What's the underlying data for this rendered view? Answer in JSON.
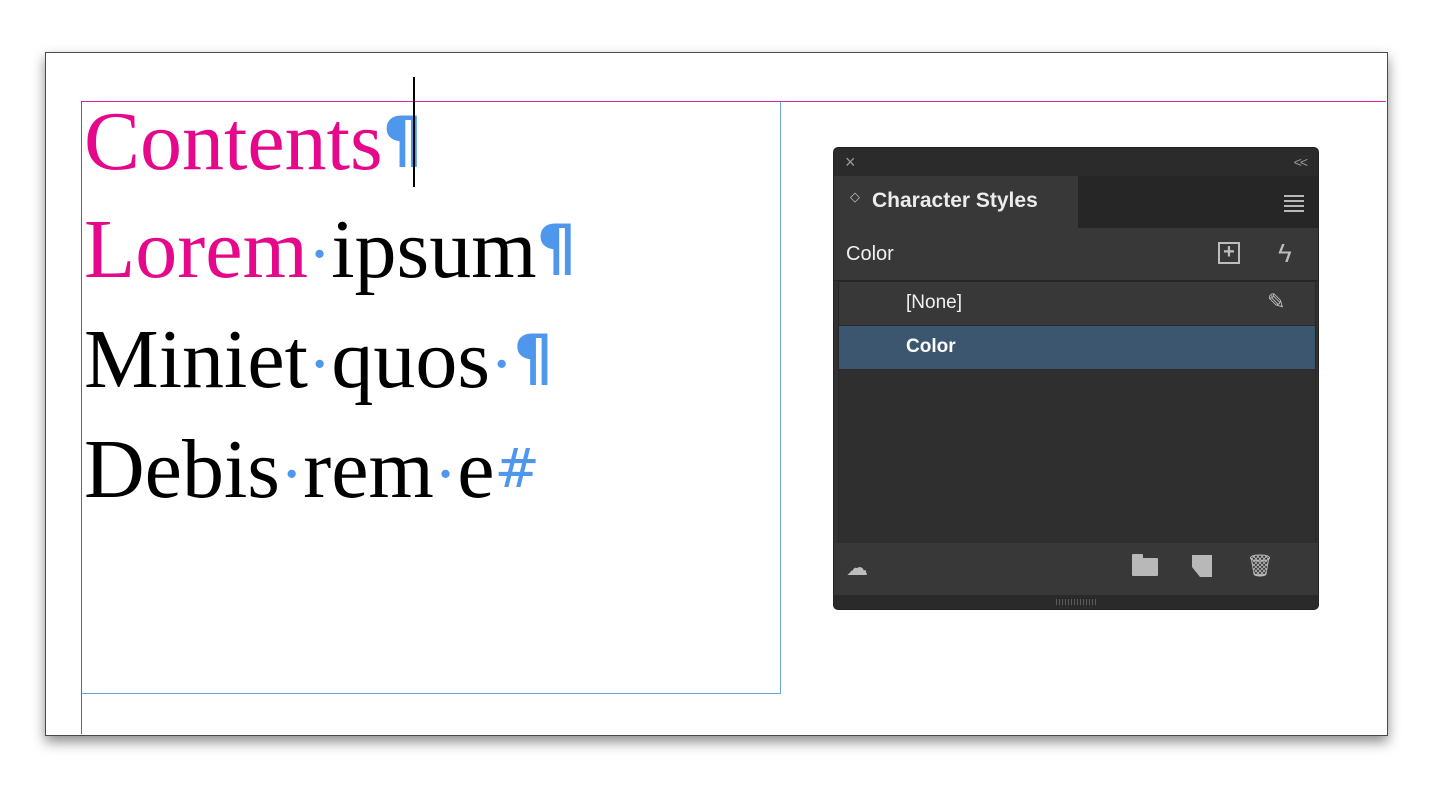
{
  "document": {
    "lines": [
      {
        "segments": [
          {
            "text": "Contents",
            "style": "pink"
          },
          {
            "text": "¶",
            "style": "hidden-pilcrow"
          }
        ]
      },
      {
        "segments": [
          {
            "text": "Lorem",
            "style": "pink"
          },
          {
            "text": "·",
            "style": "hidden-space"
          },
          {
            "text": "ipsum",
            "style": "black"
          },
          {
            "text": "¶",
            "style": "hidden-pilcrow"
          }
        ]
      },
      {
        "segments": [
          {
            "text": "Miniet",
            "style": "black"
          },
          {
            "text": "·",
            "style": "hidden-space"
          },
          {
            "text": "quos",
            "style": "black"
          },
          {
            "text": "·",
            "style": "hidden-space"
          },
          {
            "text": "¶",
            "style": "hidden-pilcrow"
          }
        ]
      },
      {
        "segments": [
          {
            "text": "Debis",
            "style": "black"
          },
          {
            "text": "·",
            "style": "hidden-space"
          },
          {
            "text": "rem",
            "style": "black"
          },
          {
            "text": "·",
            "style": "hidden-space"
          },
          {
            "text": "e",
            "style": "black"
          },
          {
            "text": "#",
            "style": "hidden-end"
          }
        ]
      }
    ],
    "colors": {
      "accent_pink": "#e5088a",
      "hidden_chars": "#4f97ec",
      "frame_guide": "#6ba4d9",
      "margin_guide": "#e0219b"
    }
  },
  "panel": {
    "close_icon": "×",
    "collapse_icon": "<<",
    "tab_arrows_icon": "◇",
    "tab_label": "Character Styles",
    "menu_icon": "hamburger-menu",
    "current_style": "Color",
    "new_group_icon": "+",
    "lightning_icon": "ϟ",
    "styles": [
      {
        "label": "[None]",
        "selected": false
      },
      {
        "label": "Color",
        "selected": true
      }
    ],
    "clear_override_icon": "✎",
    "trash_icon": "🗑",
    "cloud_icon": "☁",
    "colors": {
      "panel_bg": "#323232",
      "selected_row": "#3c5670"
    }
  }
}
